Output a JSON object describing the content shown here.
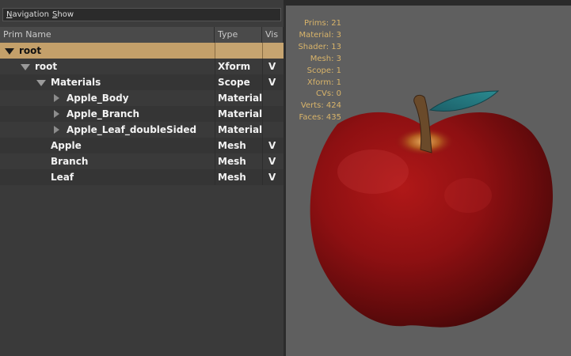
{
  "menubar": {
    "navigation": "Navigation",
    "show": "Show"
  },
  "tree": {
    "headers": {
      "name": "Prim Name",
      "type": "Type",
      "vis": "Vis"
    },
    "rows": [
      {
        "name": "root",
        "type": "",
        "vis": "",
        "expander": "expanded",
        "selected": true
      },
      {
        "name": "root",
        "type": "Xform",
        "vis": "V",
        "expander": "expanded"
      },
      {
        "name": "Materials",
        "type": "Scope",
        "vis": "V",
        "expander": "expanded"
      },
      {
        "name": "Apple_Body",
        "type": "Material",
        "vis": "",
        "expander": "collapsed"
      },
      {
        "name": "Apple_Branch",
        "type": "Material",
        "vis": "",
        "expander": "collapsed"
      },
      {
        "name": "Apple_Leaf_doubleSided",
        "type": "Material",
        "vis": "",
        "expander": "collapsed"
      },
      {
        "name": "Apple",
        "type": "Mesh",
        "vis": "V",
        "expander": "none"
      },
      {
        "name": "Branch",
        "type": "Mesh",
        "vis": "V",
        "expander": "none"
      },
      {
        "name": "Leaf",
        "type": "Mesh",
        "vis": "V",
        "expander": "none"
      }
    ]
  },
  "stats": [
    {
      "label": "Prims",
      "value": "21"
    },
    {
      "label": "Material",
      "value": "3"
    },
    {
      "label": "Shader",
      "value": "13"
    },
    {
      "label": "Mesh",
      "value": "3"
    },
    {
      "label": "Scope",
      "value": "1"
    },
    {
      "label": "Xform",
      "value": "1"
    },
    {
      "label": "CVs",
      "value": "0"
    },
    {
      "label": "Verts",
      "value": "424"
    },
    {
      "label": "Faces",
      "value": "435"
    }
  ],
  "colors": {
    "selection": "#c4a06a",
    "stats_text": "#d9b46a",
    "viewport_bg": "#5f5f5f",
    "apple_red": "#8c0f10",
    "leaf": "#1f6e78",
    "stem": "#6a4a2a"
  },
  "icons": {
    "expanded": "triangle-down-icon",
    "collapsed": "triangle-right-icon"
  }
}
